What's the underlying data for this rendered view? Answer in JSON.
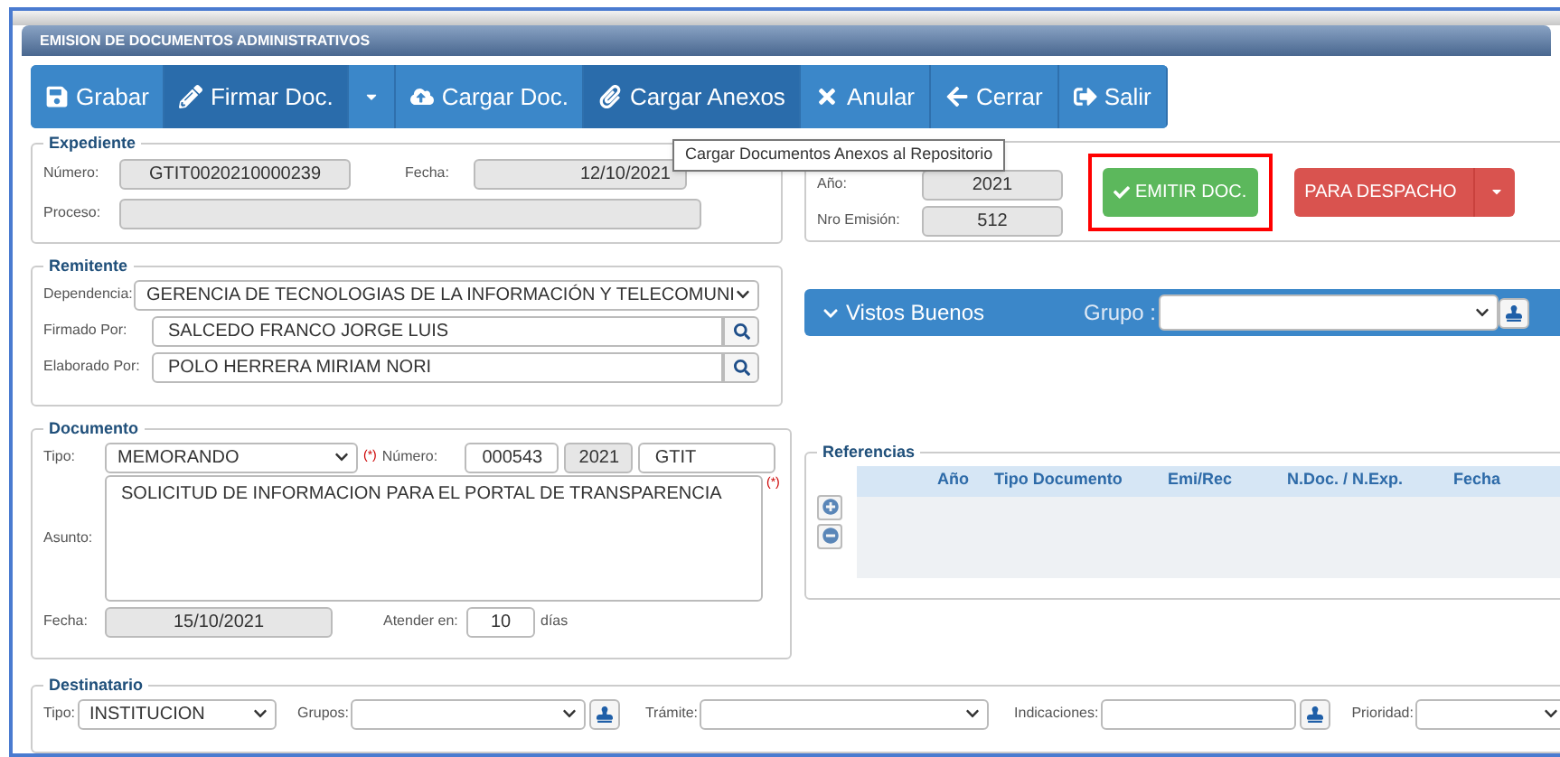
{
  "window": {
    "title": "EMISION DE DOCUMENTOS ADMINISTRATIVOS"
  },
  "toolbar": {
    "buttons": [
      {
        "kind": "button",
        "label": "Grabar",
        "active": false
      },
      {
        "kind": "button",
        "label": "Firmar Doc.",
        "active": true
      },
      {
        "kind": "caret",
        "active": false
      },
      {
        "kind": "button",
        "label": "Cargar Doc.",
        "active": false
      },
      {
        "kind": "button",
        "label": "Cargar Anexos",
        "active": true
      },
      {
        "kind": "button",
        "label": "Anular",
        "active": false
      },
      {
        "kind": "button",
        "label": "Cerrar",
        "active": false
      },
      {
        "kind": "button",
        "label": "Salir",
        "active": false
      }
    ]
  },
  "tooltip": {
    "text": "Cargar Documentos Anexos al Repositorio"
  },
  "expediente": {
    "legend": "Expediente",
    "numero": {
      "label": "Número:",
      "value": "GTIT0020210000239"
    },
    "fecha": {
      "label": "Fecha:",
      "value": "12/10/2021"
    },
    "proceso": {
      "label": "Proceso:"
    }
  },
  "emision": {
    "anio": {
      "label": "Año:",
      "value": "2021"
    },
    "nro": {
      "label": "Nro Emisión:",
      "value": "512"
    }
  },
  "actions": [
    {
      "kind": "success",
      "label": "EMITIR DOC.",
      "highlighted": true
    },
    {
      "kind": "danger",
      "label": "PARA DESPACHO",
      "highlighted": false
    }
  ],
  "remitente": {
    "legend": "Remitente",
    "dependencia": {
      "label": "Dependencia:",
      "value": "GERENCIA DE TECNOLOGIAS DE LA INFORMACIÓN Y TELECOMUNI"
    },
    "firmado": {
      "label": "Firmado Por:",
      "value": "SALCEDO FRANCO JORGE LUIS"
    },
    "elaborado": {
      "label": "Elaborado Por:",
      "value": "POLO HERRERA MIRIAM NORI"
    }
  },
  "vistos_buenos": {
    "title": "Vistos Buenos",
    "grupo_label": "Grupo :"
  },
  "documento": {
    "legend": "Documento",
    "tipo": {
      "label": "Tipo:",
      "value": "MEMORANDO"
    },
    "required_mark": "(*)",
    "numero": {
      "label": "Número:",
      "value": "000543",
      "year": "2021",
      "suffix": "GTIT"
    },
    "asunto": {
      "label": "Asunto:",
      "value": "SOLICITUD DE INFORMACION PARA EL PORTAL DE TRANSPARENCIA"
    },
    "fecha": {
      "label": "Fecha:",
      "value": "15/10/2021"
    },
    "atender": {
      "label": "Atender en:",
      "value": "10",
      "unit": "días"
    }
  },
  "referencias": {
    "legend": "Referencias",
    "columns": [
      "Año",
      "Tipo Documento",
      "Emi/Rec",
      "N.Doc. / N.Exp.",
      "Fecha"
    ]
  },
  "destinatario": {
    "legend": "Destinatario",
    "tipo": {
      "label": "Tipo:",
      "value": "INSTITUCION"
    },
    "grupos": {
      "label": "Grupos:"
    },
    "tramite": {
      "label": "Trámite:"
    },
    "indicaciones": {
      "label": "Indicaciones:"
    },
    "prioridad": {
      "label": "Prioridad:"
    }
  }
}
